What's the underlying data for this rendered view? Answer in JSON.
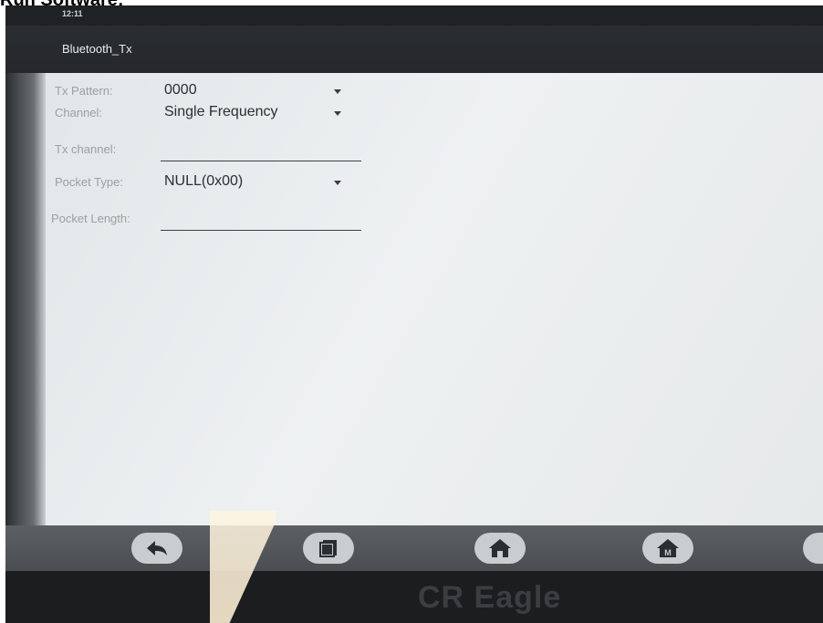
{
  "caption": "Run Software:",
  "status_bar": {
    "time": "12:11"
  },
  "app_bar": {
    "title": "Bluetooth_Tx"
  },
  "form": {
    "tx_pattern": {
      "label": "Tx Pattern:",
      "value": "0000"
    },
    "channel": {
      "label": "Channel:",
      "value": "Single Frequency"
    },
    "tx_channel": {
      "label": "Tx channel:",
      "value": ""
    },
    "pocket_type": {
      "label": "Pocket Type:",
      "value": "NULL(0x00)"
    },
    "pocket_length": {
      "label": "Pocket Length:",
      "value": ""
    }
  },
  "nav": {
    "back_icon": "back-arrow-icon",
    "recents_icon": "recents-square-icon",
    "home_icon": "home-icon",
    "menu_icon": "m-home-icon"
  },
  "device_brand": "CR Eagle",
  "colors": {
    "screen": "#e9ecee",
    "app_bar": "#26292c",
    "nav_bar": "#53575b",
    "text": "#2b2f33",
    "label": "#9aa0a4"
  }
}
